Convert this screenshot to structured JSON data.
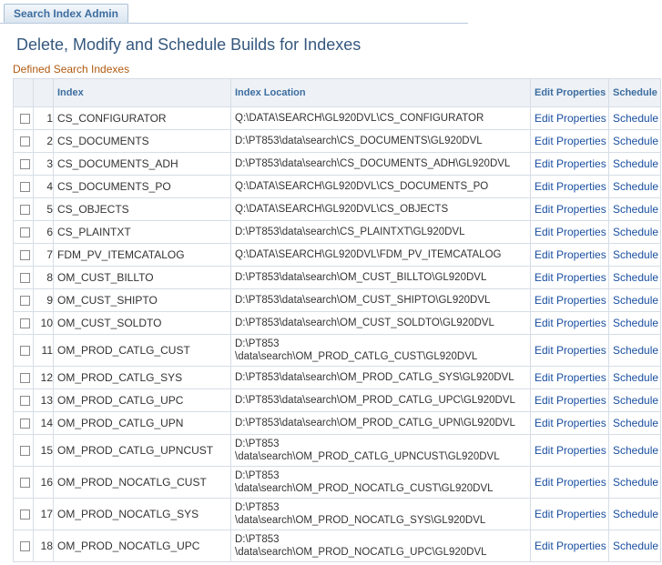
{
  "tab": {
    "label": "Search Index Admin"
  },
  "page": {
    "title": "Delete, Modify and Schedule Builds for Indexes",
    "grid_caption": "Defined Search Indexes"
  },
  "table": {
    "headers": {
      "index": "Index",
      "location": "Index Location",
      "edit": "Edit Properties",
      "schedule": "Schedule"
    },
    "rows": [
      {
        "num": "1",
        "index": "CS_CONFIGURATOR",
        "location": [
          "Q:\\DATA\\SEARCH\\GL920DVL\\CS_CONFIGURATOR"
        ],
        "edit": "Edit Properties",
        "schedule": "Schedule"
      },
      {
        "num": "2",
        "index": "CS_DOCUMENTS",
        "location": [
          "D:\\PT853\\data\\search\\CS_DOCUMENTS\\GL920DVL"
        ],
        "edit": "Edit Properties",
        "schedule": "Schedule"
      },
      {
        "num": "3",
        "index": "CS_DOCUMENTS_ADH",
        "location": [
          "D:\\PT853\\data\\search\\CS_DOCUMENTS_ADH\\GL920DVL"
        ],
        "edit": "Edit Properties",
        "schedule": "Schedule"
      },
      {
        "num": "4",
        "index": "CS_DOCUMENTS_PO",
        "location": [
          "Q:\\DATA\\SEARCH\\GL920DVL\\CS_DOCUMENTS_PO"
        ],
        "edit": "Edit Properties",
        "schedule": "Schedule"
      },
      {
        "num": "5",
        "index": "CS_OBJECTS",
        "location": [
          "Q:\\DATA\\SEARCH\\GL920DVL\\CS_OBJECTS"
        ],
        "edit": "Edit Properties",
        "schedule": "Schedule"
      },
      {
        "num": "6",
        "index": "CS_PLAINTXT",
        "location": [
          "D:\\PT853\\data\\search\\CS_PLAINTXT\\GL920DVL"
        ],
        "edit": "Edit Properties",
        "schedule": "Schedule"
      },
      {
        "num": "7",
        "index": "FDM_PV_ITEMCATALOG",
        "location": [
          "Q:\\DATA\\SEARCH\\GL920DVL\\FDM_PV_ITEMCATALOG"
        ],
        "edit": "Edit Properties",
        "schedule": "Schedule"
      },
      {
        "num": "8",
        "index": "OM_CUST_BILLTO",
        "location": [
          "D:\\PT853\\data\\search\\OM_CUST_BILLTO\\GL920DVL"
        ],
        "edit": "Edit Properties",
        "schedule": "Schedule"
      },
      {
        "num": "9",
        "index": "OM_CUST_SHIPTO",
        "location": [
          "D:\\PT853\\data\\search\\OM_CUST_SHIPTO\\GL920DVL"
        ],
        "edit": "Edit Properties",
        "schedule": "Schedule"
      },
      {
        "num": "10",
        "index": "OM_CUST_SOLDTO",
        "location": [
          "D:\\PT853\\data\\search\\OM_CUST_SOLDTO\\GL920DVL"
        ],
        "edit": "Edit Properties",
        "schedule": "Schedule"
      },
      {
        "num": "11",
        "index": "OM_PROD_CATLG_CUST",
        "location": [
          "D:\\PT853",
          "\\data\\search\\OM_PROD_CATLG_CUST\\GL920DVL"
        ],
        "edit": "Edit Properties",
        "schedule": "Schedule"
      },
      {
        "num": "12",
        "index": "OM_PROD_CATLG_SYS",
        "location": [
          "D:\\PT853\\data\\search\\OM_PROD_CATLG_SYS\\GL920DVL"
        ],
        "edit": "Edit Properties",
        "schedule": "Schedule"
      },
      {
        "num": "13",
        "index": "OM_PROD_CATLG_UPC",
        "location": [
          "D:\\PT853\\data\\search\\OM_PROD_CATLG_UPC\\GL920DVL"
        ],
        "edit": "Edit Properties",
        "schedule": "Schedule"
      },
      {
        "num": "14",
        "index": "OM_PROD_CATLG_UPN",
        "location": [
          "D:\\PT853\\data\\search\\OM_PROD_CATLG_UPN\\GL920DVL"
        ],
        "edit": "Edit Properties",
        "schedule": "Schedule"
      },
      {
        "num": "15",
        "index": "OM_PROD_CATLG_UPNCUST",
        "location": [
          "D:\\PT853",
          "\\data\\search\\OM_PROD_CATLG_UPNCUST\\GL920DVL"
        ],
        "edit": "Edit Properties",
        "schedule": "Schedule"
      },
      {
        "num": "16",
        "index": "OM_PROD_NOCATLG_CUST",
        "location": [
          "D:\\PT853",
          "\\data\\search\\OM_PROD_NOCATLG_CUST\\GL920DVL"
        ],
        "edit": "Edit Properties",
        "schedule": "Schedule"
      },
      {
        "num": "17",
        "index": "OM_PROD_NOCATLG_SYS",
        "location": [
          "D:\\PT853",
          "\\data\\search\\OM_PROD_NOCATLG_SYS\\GL920DVL"
        ],
        "edit": "Edit Properties",
        "schedule": "Schedule"
      },
      {
        "num": "18",
        "index": "OM_PROD_NOCATLG_UPC",
        "location": [
          "D:\\PT853",
          "\\data\\search\\OM_PROD_NOCATLG_UPC\\GL920DVL"
        ],
        "edit": "Edit Properties",
        "schedule": "Schedule"
      }
    ]
  }
}
